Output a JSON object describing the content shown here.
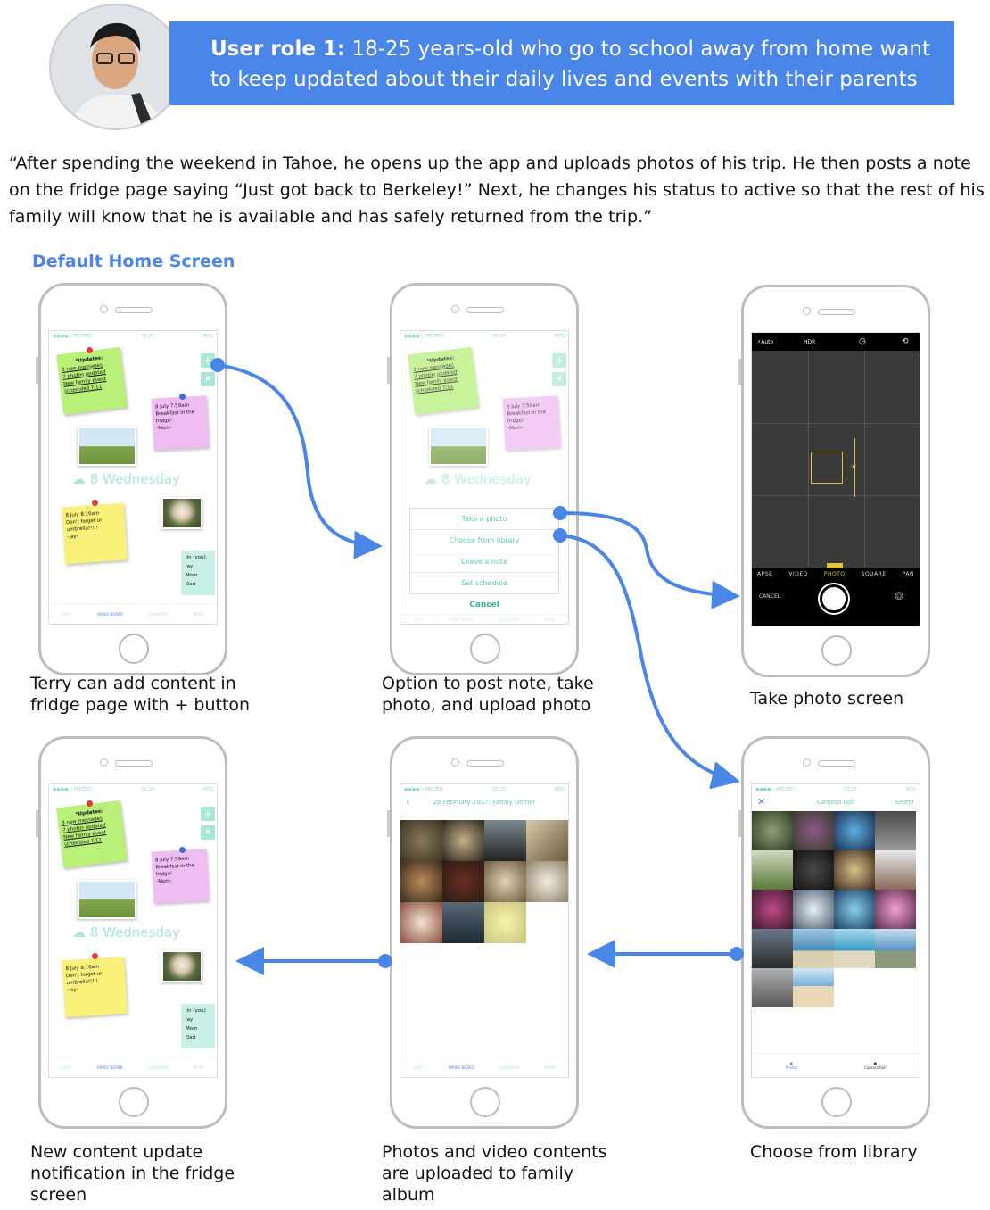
{
  "header": {
    "role_label": "User role 1:",
    "role_text": " 18-25 years-old who go to school away from home want to keep updated about their daily lives and events with their parents"
  },
  "scenario": "“After spending the weekend in Tahoe, he opens up the app and uploads photos of his trip. He then posts a note on the fridge page saying “Just got back to Berkeley!” Next, he changes his status to active so that the rest of his family will know that he is available and has safely returned from the trip.”",
  "section_title": "Default Home Screen",
  "captions": {
    "home": "Terry can add content in fridge page with + button",
    "options": "Option to post note, take photo, and upload photo",
    "take_photo": "Take photo screen",
    "updated": "New content update notification in the fridge screen",
    "album": "Photos and video contents are uploaded to family album",
    "library": "Choose from library"
  },
  "fridge": {
    "updates_title": "*Updates:",
    "updates": [
      "3 new messages",
      "7 photos updated",
      "New family event scheduled 7/11"
    ],
    "pink_note": [
      "8 July 7:59am",
      "Breakfast in the fridge!",
      "-Mom-"
    ],
    "date_label": "8 Wednesday",
    "yellow_note": [
      "8 July 8:16am",
      "Don't forget ur umbrella!!!!!",
      "-Jay-"
    ],
    "members": [
      "Jin (you)",
      "Jay",
      "Mom",
      "Dad"
    ],
    "tabs": [
      "CHAT",
      "FAMILY BOARD",
      "CALENDAR",
      "MORE"
    ],
    "plus": "+",
    "star": "★"
  },
  "sheet": {
    "options": [
      "Take a photo",
      "Choose from library",
      "Leave a note",
      "Set schedule"
    ],
    "cancel": "Cancel"
  },
  "camera": {
    "flash": "Auto",
    "hdr": "HDR",
    "modes": [
      "APSE",
      "VIDEO",
      "PHOTO",
      "SQUARE",
      "PAN"
    ],
    "cancel": "CANCEL"
  },
  "album": {
    "title": "26 February 2017: Family Dinner"
  },
  "library": {
    "title": "Camera Roll",
    "select": "Select",
    "tabs": [
      "Photos",
      "Camera Roll"
    ]
  },
  "colors": {
    "accent": "#4a86e8",
    "mint": "#a8e6d8",
    "note_green": "#b8f07a",
    "note_pink": "#efbdf3",
    "note_yellow": "#f9f17a"
  }
}
